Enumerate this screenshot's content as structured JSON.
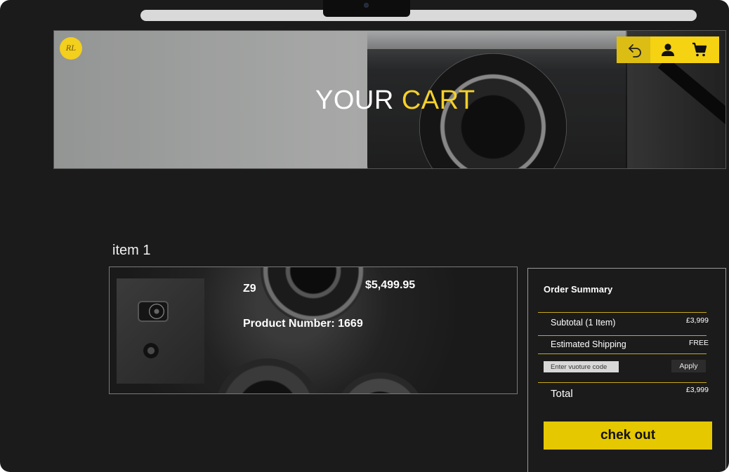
{
  "hero": {
    "logo_text": "RL",
    "title_main": "YOUR",
    "title_accent": "CART"
  },
  "nav": {
    "icons": [
      "back-arrow-icon",
      "user-icon",
      "shopping-cart-icon"
    ],
    "accent_color": "#f5d212"
  },
  "cart": {
    "item_heading": "item 1",
    "item": {
      "name": "Z9",
      "price": "$5,499.95",
      "product_number": "Product Number: 1669"
    }
  },
  "summary": {
    "title": "Order Summary",
    "subtotal_label": "Subtotal (1 Item)",
    "subtotal_value": "£3,999",
    "shipping_label": "Estimated Shipping",
    "shipping_value": "FREE",
    "voucher_placeholder": "Enter vuoture code",
    "apply_label": "Apply",
    "total_label": "Total",
    "total_value": "£3,999",
    "checkout_label": "chek out",
    "checkout_color": "#e6c800"
  }
}
